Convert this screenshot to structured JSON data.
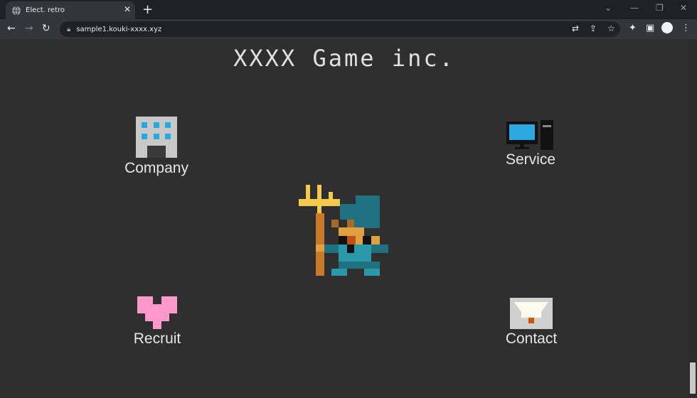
{
  "browser": {
    "tab_title": "Elect. retro",
    "url": "sample1.kouki-xxxx.xyz"
  },
  "page": {
    "title": "XXXX Game inc.",
    "menu": {
      "company": "Company",
      "service": "Service",
      "recruit": "Recruit",
      "contact": "Contact"
    }
  },
  "colors": {
    "background": "#2f2f2f",
    "text": "#e6e6e6",
    "building": "#c8c8c8",
    "window_blue": "#29a9e0",
    "heart_pink": "#ff99cc",
    "trident_gold": "#f2c94c",
    "staff_orange": "#c87a2a",
    "hero_teal": "#1f7080"
  }
}
